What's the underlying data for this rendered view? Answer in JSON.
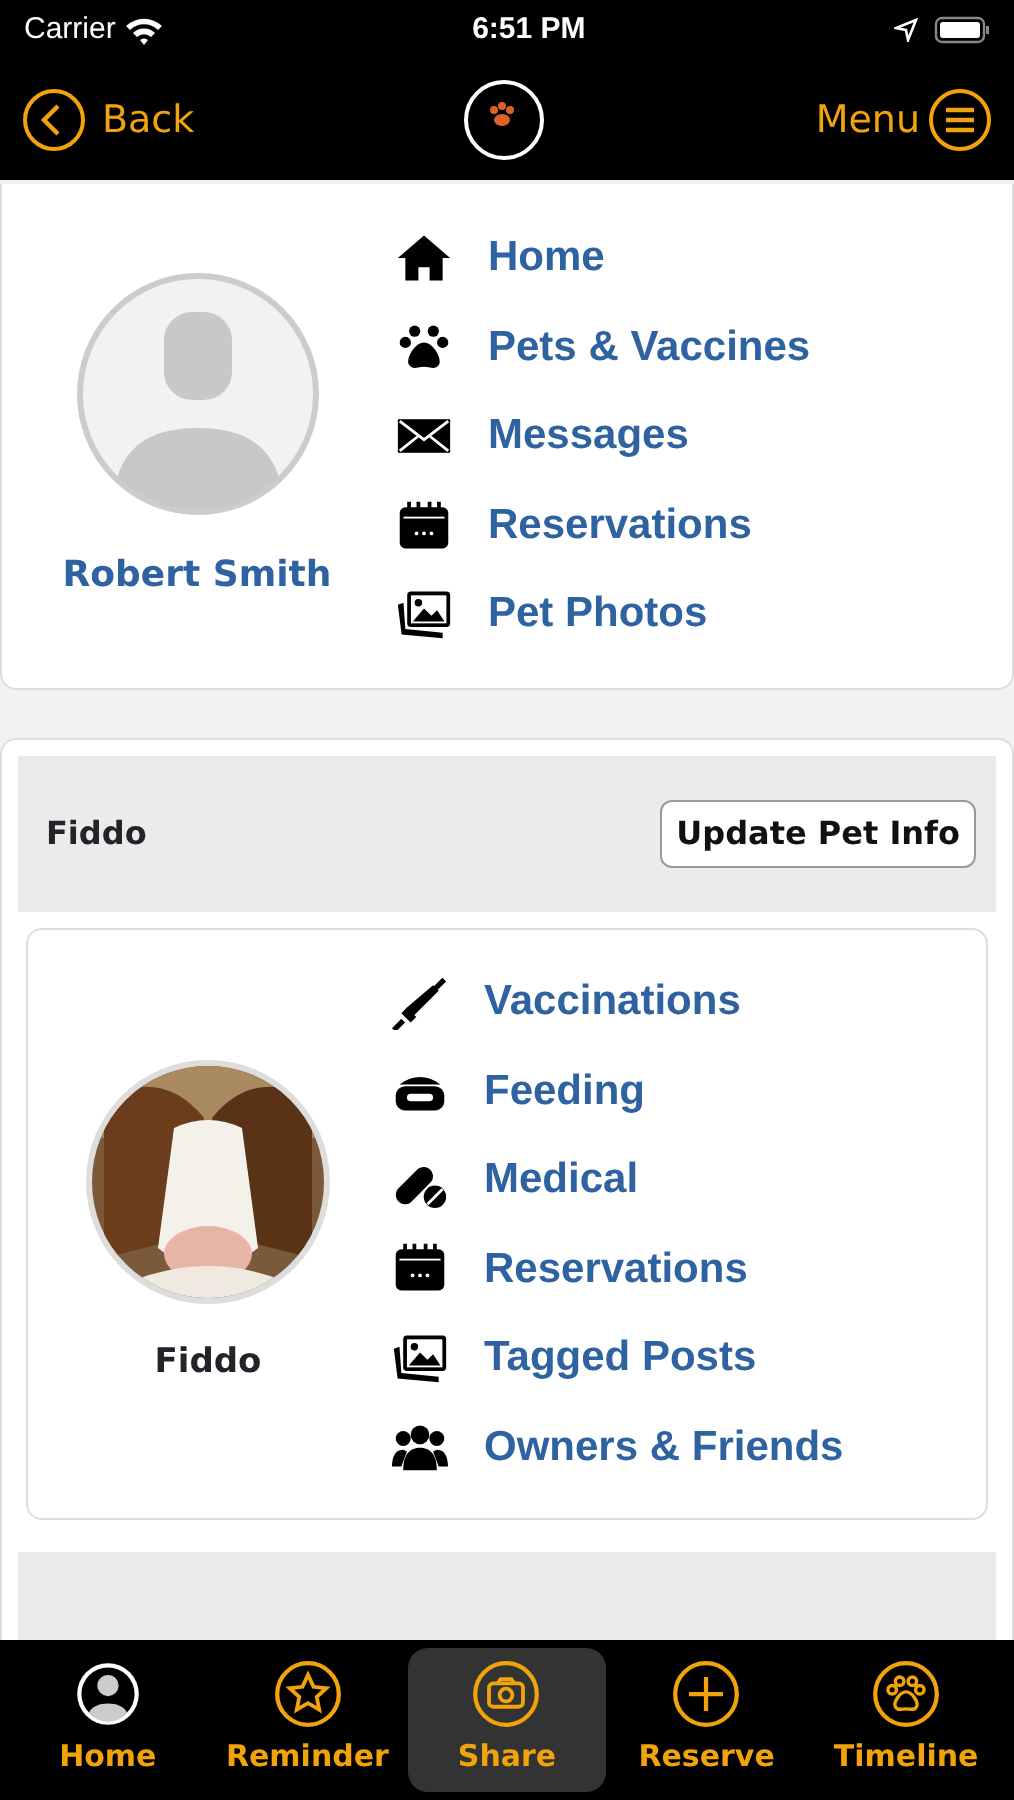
{
  "status_bar": {
    "carrier": "Carrier",
    "time": "6:51 PM"
  },
  "nav_bar": {
    "back": "Back",
    "menu": "Menu"
  },
  "user": {
    "name": "Robert Smith",
    "links": [
      {
        "label": "Home",
        "kind": "home"
      },
      {
        "label": "Pets & Vaccines",
        "kind": "paw"
      },
      {
        "label": "Messages",
        "kind": "mail"
      },
      {
        "label": "Reservations",
        "kind": "calendar"
      },
      {
        "label": "Pet Photos",
        "kind": "photos"
      }
    ]
  },
  "pet": {
    "header": "Fiddo",
    "update_button": "Update Pet Info",
    "name": "Fiddo",
    "links": [
      {
        "label": "Vaccinations",
        "kind": "syringe"
      },
      {
        "label": "Feeding",
        "kind": "bowl"
      },
      {
        "label": "Medical",
        "kind": "pills"
      },
      {
        "label": "Reservations",
        "kind": "calendar"
      },
      {
        "label": "Tagged Posts",
        "kind": "photos"
      },
      {
        "label": "Owners & Friends",
        "kind": "people"
      }
    ]
  },
  "tab_bar": [
    {
      "label": "Home",
      "kind": "person",
      "selected": false
    },
    {
      "label": "Reminder",
      "kind": "star",
      "selected": false
    },
    {
      "label": "Share",
      "kind": "camera",
      "selected": true
    },
    {
      "label": "Reserve",
      "kind": "plus",
      "selected": false
    },
    {
      "label": "Timeline",
      "kind": "paw",
      "selected": false
    }
  ]
}
